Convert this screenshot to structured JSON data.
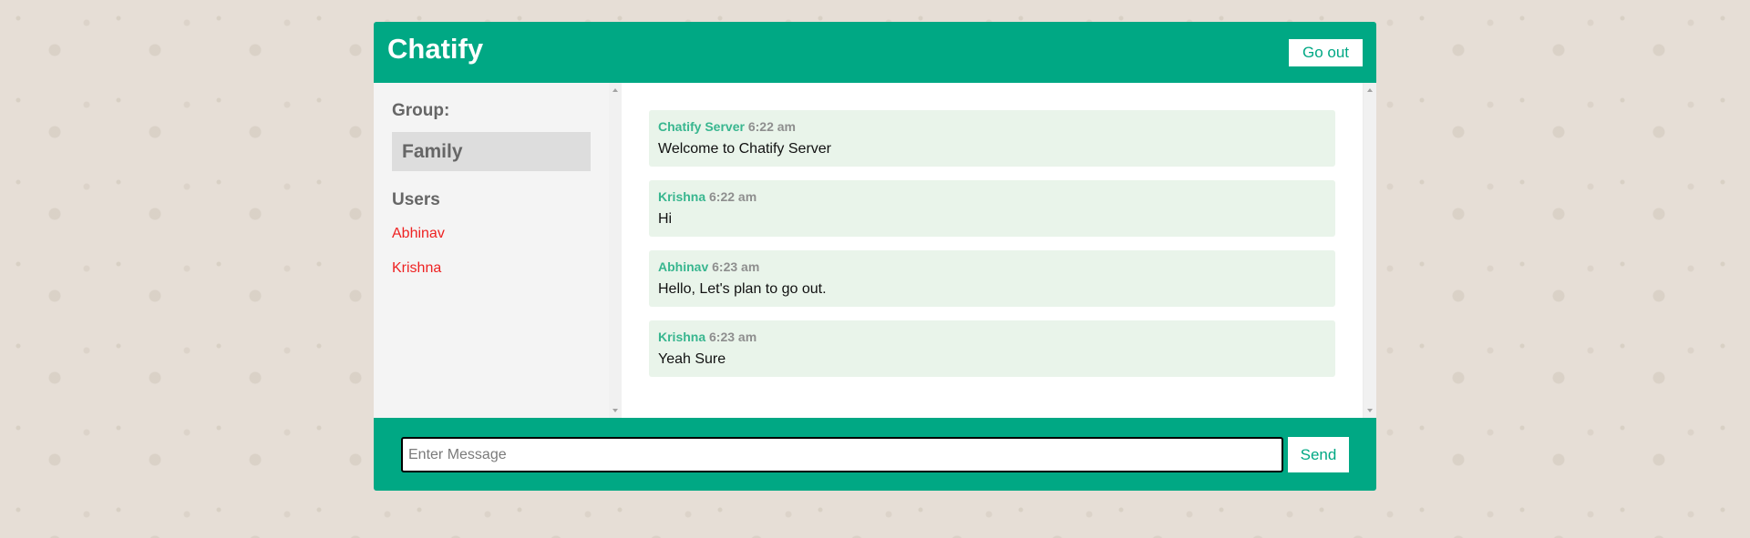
{
  "header": {
    "title": "Chatify",
    "leave_label": "Go out"
  },
  "sidebar": {
    "group_heading": "Group:",
    "group_name": "Family",
    "users_heading": "Users",
    "users": [
      "Abhinav",
      "Krishna"
    ]
  },
  "messages": [
    {
      "author": "Chatify Server",
      "time": "6:22 am",
      "text": "Welcome to Chatify Server"
    },
    {
      "author": "Krishna",
      "time": "6:22 am",
      "text": "Hi"
    },
    {
      "author": "Abhinav",
      "time": "6:23 am",
      "text": "Hello, Let's plan to go out."
    },
    {
      "author": "Krishna",
      "time": "6:23 am",
      "text": "Yeah Sure"
    }
  ],
  "composer": {
    "placeholder": "Enter Message",
    "value": "",
    "send_label": "Send"
  },
  "colors": {
    "brand": "#00a884",
    "message_bg": "#e9f4ea",
    "author": "#38b68f",
    "user_link": "#ee2222"
  }
}
